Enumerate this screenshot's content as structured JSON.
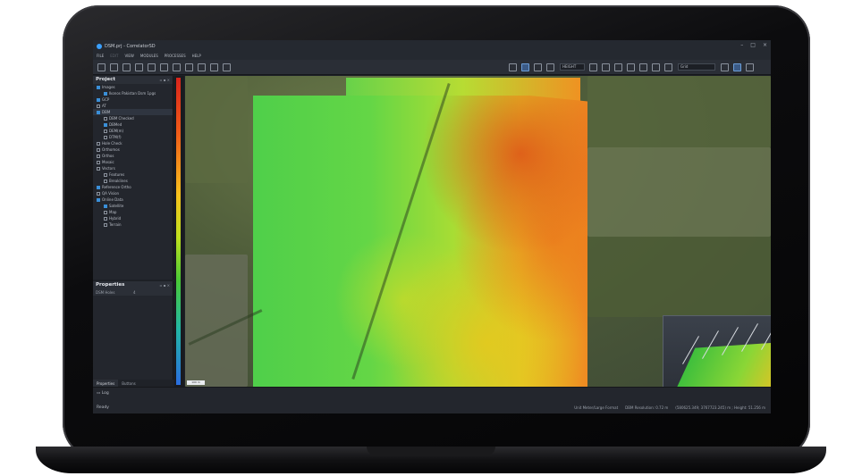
{
  "window": {
    "title": "DSM.prj - CorrelatorSD"
  },
  "menu": [
    {
      "label": "FILE"
    },
    {
      "label": "EDIT",
      "disabled": true
    },
    {
      "label": "VIEW"
    },
    {
      "label": "MODULES"
    },
    {
      "label": "PROCESSES"
    },
    {
      "label": "HELP"
    }
  ],
  "toolbar": {
    "layer_select": "HEIGHT",
    "mode_select": "Grid"
  },
  "project_panel": {
    "title": "Project",
    "items": [
      {
        "label": "Images",
        "level": 0,
        "checked": true
      },
      {
        "label": "Ikonos Pakistan Dsm 1pgs",
        "level": 1,
        "checked": true
      },
      {
        "label": "GCP",
        "level": 0,
        "checked": true
      },
      {
        "label": "AT",
        "level": 0,
        "checked": false
      },
      {
        "label": "DBM",
        "level": 0,
        "checked": true,
        "selected": true
      },
      {
        "label": "DBM Checked",
        "level": 1,
        "checked": false
      },
      {
        "label": "DBMed",
        "level": 1,
        "checked": true
      },
      {
        "label": "DEM(m)",
        "level": 1,
        "checked": false
      },
      {
        "label": "DTM(f)",
        "level": 1,
        "checked": false
      },
      {
        "label": "Hole Check",
        "level": 0,
        "checked": false
      },
      {
        "label": "Orthomos",
        "level": 0,
        "checked": false
      },
      {
        "label": "Orthos",
        "level": 0,
        "checked": false
      },
      {
        "label": "Mosaic",
        "level": 0,
        "checked": false
      },
      {
        "label": "Vectors",
        "level": 0,
        "checked": false
      },
      {
        "label": "Features",
        "level": 1,
        "checked": false
      },
      {
        "label": "Breaklines",
        "level": 1,
        "checked": false
      },
      {
        "label": "Reference Ortho",
        "level": 0,
        "checked": true
      },
      {
        "label": "QA Vision",
        "level": 0,
        "checked": false
      },
      {
        "label": "Online Data",
        "level": 0,
        "checked": true
      },
      {
        "label": "Satellite",
        "level": 1,
        "checked": true
      },
      {
        "label": "Map",
        "level": 1,
        "checked": false
      },
      {
        "label": "Hybrid",
        "level": 1,
        "checked": false
      },
      {
        "label": "Terrain",
        "level": 1,
        "checked": false
      }
    ]
  },
  "properties_panel": {
    "title": "Properties",
    "rows": [
      {
        "label": "DSM Holes",
        "value": "4"
      }
    ],
    "tabs": [
      {
        "label": "Properties",
        "active": true
      },
      {
        "label": "Buttons",
        "active": false
      }
    ]
  },
  "viewport": {
    "scale_label": "100 m"
  },
  "statusbar": {
    "log_label": "Log",
    "ready_label": "Ready",
    "format": "Unit Meter/Large Format",
    "resolution": "DBM Resolution: 0.72 m",
    "coordinates": "(580625.349; 3767723.245) m ; Height: 51.256 m"
  },
  "colors": {
    "app_bg": "#1d2026",
    "panel_bg": "#23262d",
    "accent": "#3a8fd8"
  }
}
